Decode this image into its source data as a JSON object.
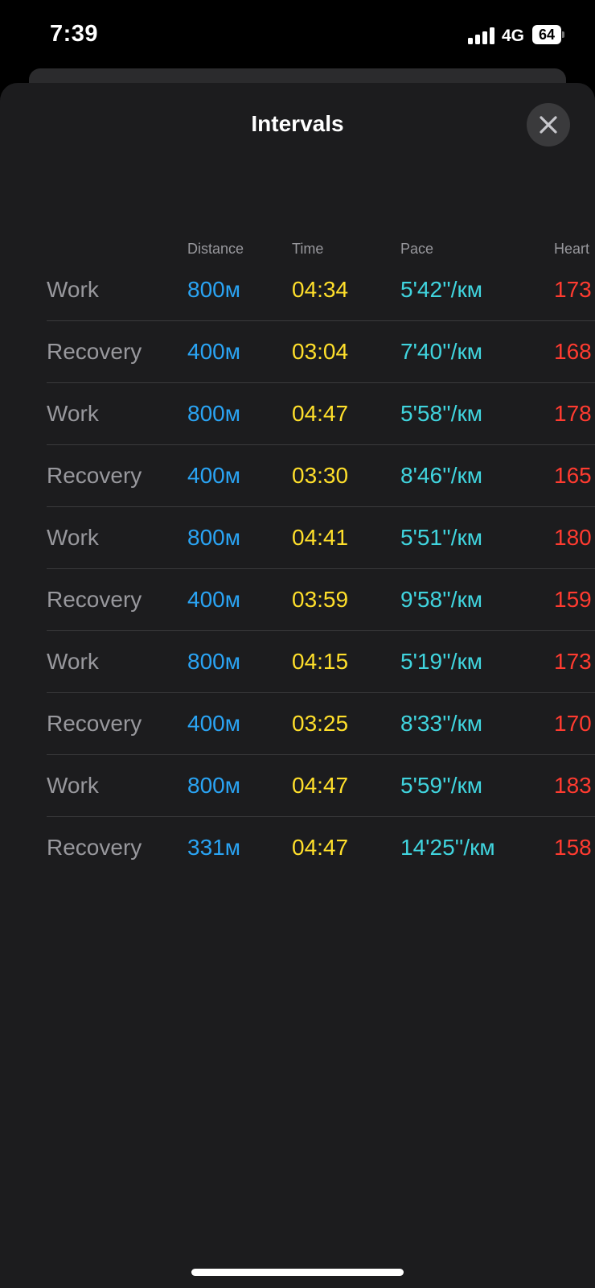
{
  "status_bar": {
    "time": "7:39",
    "network": "4G",
    "battery": "64"
  },
  "sheet": {
    "title": "Intervals"
  },
  "table": {
    "headers": [
      "Distance",
      "Time",
      "Pace",
      "Heart"
    ],
    "rows": [
      {
        "label": "Work",
        "distance": "800м",
        "time": "04:34",
        "pace": "5'42''/км",
        "heart": "173"
      },
      {
        "label": "Recovery",
        "distance": "400м",
        "time": "03:04",
        "pace": "7'40''/км",
        "heart": "168"
      },
      {
        "label": "Work",
        "distance": "800м",
        "time": "04:47",
        "pace": "5'58''/км",
        "heart": "178"
      },
      {
        "label": "Recovery",
        "distance": "400м",
        "time": "03:30",
        "pace": "8'46''/км",
        "heart": "165"
      },
      {
        "label": "Work",
        "distance": "800м",
        "time": "04:41",
        "pace": "5'51''/км",
        "heart": "180"
      },
      {
        "label": "Recovery",
        "distance": "400м",
        "time": "03:59",
        "pace": "9'58''/км",
        "heart": "159"
      },
      {
        "label": "Work",
        "distance": "800м",
        "time": "04:15",
        "pace": "5'19''/км",
        "heart": "173"
      },
      {
        "label": "Recovery",
        "distance": "400м",
        "time": "03:25",
        "pace": "8'33''/км",
        "heart": "170"
      },
      {
        "label": "Work",
        "distance": "800м",
        "time": "04:47",
        "pace": "5'59''/км",
        "heart": "183"
      },
      {
        "label": "Recovery",
        "distance": "331м",
        "time": "04:47",
        "pace": "14'25''/км",
        "heart": "158"
      }
    ]
  },
  "colors": {
    "background": "#1c1c1e",
    "distance": "#2aa4f4",
    "time": "#ffdf2b",
    "pace": "#40d4de",
    "heart": "#ff3b30",
    "label": "#98989d"
  },
  "icons": {
    "close": "close-icon",
    "signal": "signal-icon",
    "battery": "battery-icon"
  }
}
